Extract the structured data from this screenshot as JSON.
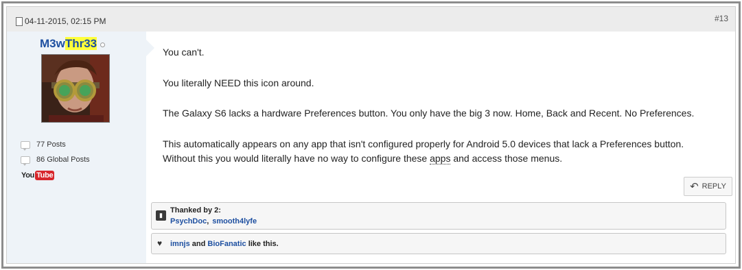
{
  "post": {
    "date": "04-11-2015, 02:15 PM",
    "number": "#13"
  },
  "author": {
    "name_part1": "M3w",
    "name_part2": "Thr33",
    "posts": "77 Posts",
    "global_posts": "86 Global Posts",
    "youtube_you": "You",
    "youtube_tube": "Tube"
  },
  "message": {
    "line1": "You can't.",
    "line2": "You literally NEED this icon around.",
    "line3": "The Galaxy S6 lacks a hardware Preferences button. You only have the big 3 now. Home, Back and Recent. No Preferences.",
    "line4a": "This automatically appears on any app that isn't configured properly for Android 5.0 devices that lack a Preferences button.",
    "line4b_pre": "Without this you would literally have no way to configure these ",
    "line4b_link": "apps",
    "line4b_post": " and access those menus."
  },
  "actions": {
    "reply_label": "REPLY"
  },
  "thanks": {
    "title": "Thanked by 2:",
    "user1": "PsychDoc",
    "separator": ",",
    "user2": "smooth4lyfe"
  },
  "likes": {
    "user1": "imnjs",
    "and": " and ",
    "user2": "BioFanatic",
    "suffix": " like this."
  },
  "colors": {
    "username": "#1d4fa0",
    "highlight": "#ffff3a",
    "sidebar_bg": "#eef3f8",
    "youtube_red": "#d7262b"
  },
  "icons": [
    "document-icon",
    "online-status-icon",
    "post-count-icon",
    "youtube-icon",
    "reply-icon",
    "thumbs-up-icon",
    "heart-icon"
  ]
}
